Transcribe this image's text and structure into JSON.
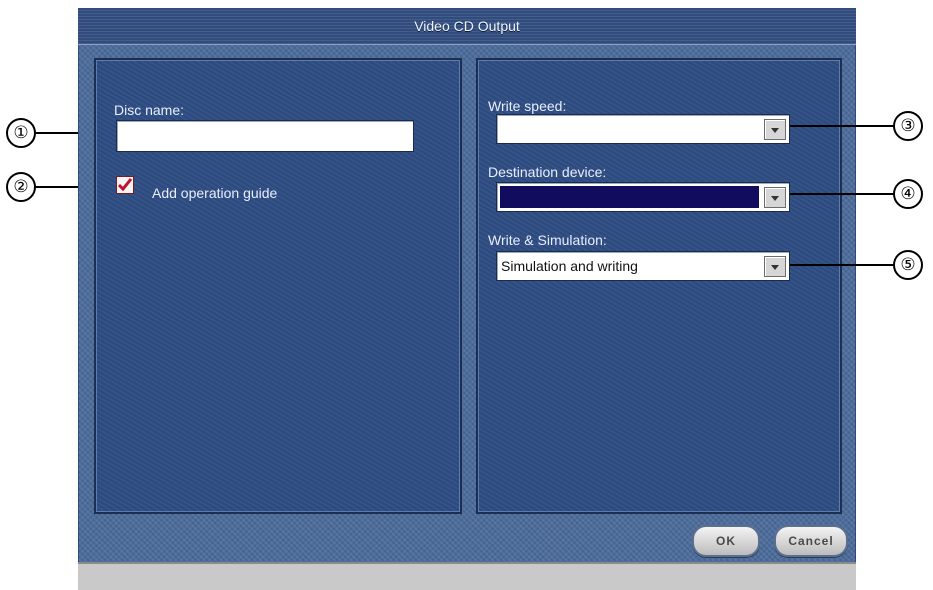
{
  "window": {
    "title": "Video CD Output"
  },
  "left_panel": {
    "disc_name_label": "Disc name:",
    "disc_name_value": "",
    "operation_guide_label": "Add operation guide",
    "operation_guide_checked": true
  },
  "right_panel": {
    "write_speed_label": "Write speed:",
    "write_speed_value": "",
    "destination_label": "Destination device:",
    "destination_value": "",
    "write_sim_label": "Write & Simulation:",
    "write_sim_value": "Simulation and writing"
  },
  "buttons": {
    "ok": "OK",
    "cancel": "Cancel"
  },
  "callouts": [
    "①",
    "②",
    "③",
    "④",
    "⑤"
  ],
  "colors": {
    "dialog_bg": "#4a6a9a",
    "panel_bg": "#2e4d82",
    "destination_fill": "#120c5e",
    "checkmark": "#c0102a"
  },
  "icons": {
    "checkbox": "checkmark-icon",
    "dropdown": "chevron-down-icon"
  }
}
